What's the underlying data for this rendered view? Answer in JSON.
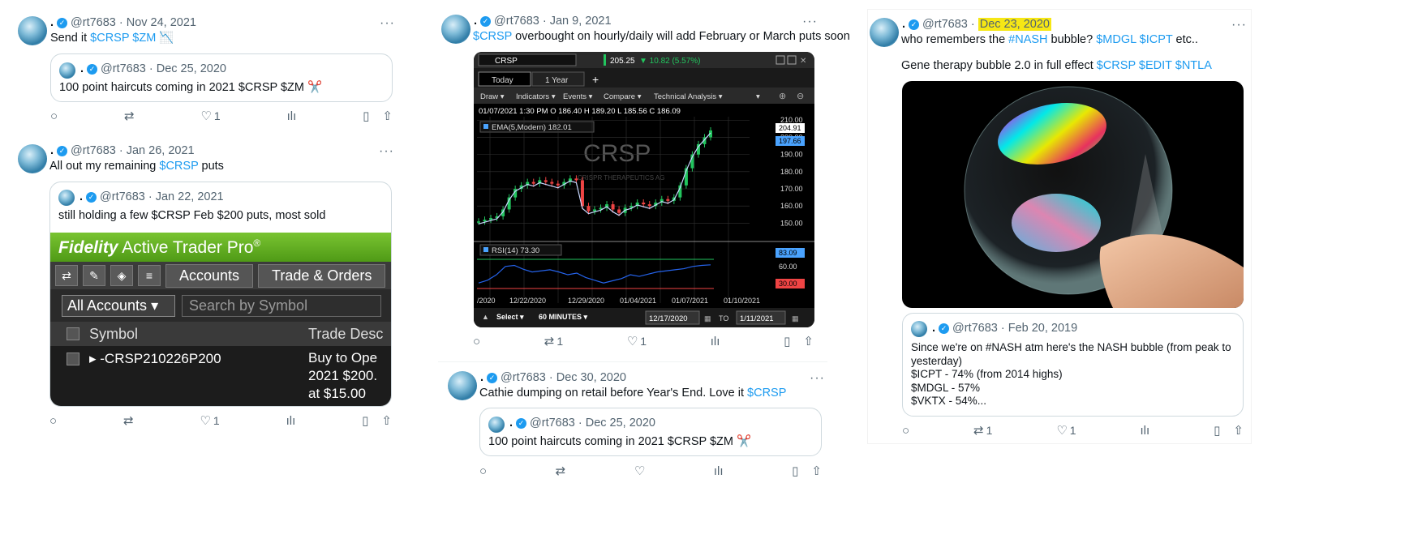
{
  "colors": {
    "accent": "#1d9bf0",
    "muted": "#536471",
    "highlight": "#f6e715",
    "candle_up": "#22c55e",
    "candle_down": "#ef4444",
    "ema": "#c8d8ff",
    "rsi": "#2563eb"
  },
  "t1": {
    "name": ".",
    "verified": "✓",
    "handle": "@rt7683",
    "date": "· Nov 24, 2021",
    "text": "Send it ",
    "c1": "$CRSP",
    "c2": "$ZM",
    "emoji": "📉",
    "quote": {
      "name": ".",
      "handle": "@rt7683",
      "date": "· Dec 25, 2020",
      "text": "100 point haircuts coming in 2021 $CRSP $ZM ✂️"
    },
    "actions": {
      "reply": "",
      "retweet": "",
      "like": "1"
    }
  },
  "t2": {
    "name": ".",
    "handle": "@rt7683",
    "date": "· Jan 26, 2021",
    "text": "All out my remaining ",
    "c1": "$CRSP",
    "text2": " puts",
    "quote": {
      "name": ".",
      "handle": "@rt7683",
      "date": "· Jan 22, 2021",
      "text": "still holding a few $CRSP Feb $200 puts, most sold"
    },
    "fidelity": {
      "title_a": "Fidelity",
      "title_b": " Active Trader Pro",
      "reg": "®",
      "tab1": "Accounts",
      "tab2": "Trade & Orders",
      "accounts": "All Accounts",
      "search": "Search by Symbol",
      "col_symbol": "Symbol",
      "col_desc": "Trade Desc",
      "row_symbol": "-CRSP210226P200",
      "row_desc1": "Buy to Ope",
      "row_desc2": "2021 $200.",
      "row_desc3": "at $15.00"
    },
    "actions": {
      "like": "1"
    }
  },
  "t3": {
    "name": ".",
    "handle": "@rt7683",
    "date": "· Jan 9, 2021",
    "c1": "$CRSP",
    "text": " overbought on hourly/daily will add February or March puts soon",
    "chart": {
      "symbol": "CRSP",
      "price": "205.25",
      "change": "▼ 10.82 (5.57%)",
      "tab_today": "Today",
      "tab_year": "1 Year",
      "menu": [
        "Draw ▾",
        "Indicators ▾",
        "Events ▾",
        "Compare ▾",
        "Technical Analysis ▾"
      ],
      "ohlc": "01/07/2021 1:30 PM  O 186.40  H 189.20  L 185.56  C 186.09",
      "ema": "EMA(5,Modern) 182.01",
      "watermark": "CRSP",
      "watermark_sub": "CRISPR THERAPEUTICS AG",
      "price_ticks": [
        "210.00",
        "200.00",
        "190.00",
        "180.00",
        "170.00",
        "160.00",
        "150.00"
      ],
      "tag_a": "204.91",
      "tag_b": "197.66",
      "rsi_label": "RSI(14) 73.30",
      "rsi_ticks": [
        "60.00"
      ],
      "rsi_tag_hi": "83.09",
      "rsi_tag_lo": "30.00",
      "dates": [
        "/2020",
        "12/22/2020",
        "12/29/2020",
        "01/04/2021",
        "01/07/2021",
        "01/10/2021"
      ],
      "select": "Select ▾",
      "interval": "60 MINUTES ▾",
      "from": "12/17/2020",
      "to_label": "TO",
      "to": "1/11/2021"
    },
    "chart_data": {
      "type": "line",
      "series": [
        {
          "name": "",
          "values": [
            151,
            152,
            153,
            154,
            158,
            165,
            170,
            172,
            174,
            173,
            175,
            174,
            173,
            172,
            174,
            176,
            175,
            160,
            157,
            158,
            159,
            161,
            158,
            156,
            159,
            160,
            162,
            161,
            160,
            162,
            164,
            163,
            165,
            172,
            182,
            190,
            196,
            200,
            204
          ]
        }
      ],
      "rsi": [
        40,
        45,
        55,
        70,
        72,
        65,
        60,
        62,
        64,
        60,
        55,
        58,
        50,
        45,
        40,
        44,
        48,
        55,
        52,
        56,
        60,
        62,
        64,
        66,
        70,
        72,
        73
      ]
    },
    "actions": {
      "retweet": "1",
      "like": "1"
    }
  },
  "t4": {
    "name": ".",
    "handle": "@rt7683",
    "date": "· Dec 30, 2020",
    "text": "Cathie dumping on retail before Year's End. Love it ",
    "c1": "$CRSP",
    "quote": {
      "name": ".",
      "handle": "@rt7683",
      "date": "· Dec 25, 2020",
      "text": "100 point haircuts coming in 2021 $CRSP $ZM ✂️"
    }
  },
  "t5": {
    "name": ".",
    "handle": "@rt7683",
    "date": "Dec 23, 2020",
    "sep": "· ",
    "t1": "who remembers the ",
    "c1": "#NASH",
    "t2": " bubble? ",
    "c2": "$MDGL",
    "c3": "$ICPT",
    "t3": " etc..",
    "line2": "Gene therapy bubble 2.0 in full effect ",
    "c4": "$CRSP",
    "c5": "$EDIT",
    "c6": "$NTLA",
    "quote": {
      "name": ".",
      "handle": "@rt7683",
      "date": "· Feb 20, 2019",
      "l1": "Since we're on #NASH atm here's the NASH bubble (from peak to",
      "l2": "yesterday)",
      "l3": "$ICPT - 74% (from 2014 highs)",
      "l4": "$MDGL - 57%",
      "l5": "$VKTX - 54%..."
    },
    "actions": {
      "retweet": "1",
      "like": "1"
    }
  },
  "icons": {
    "reply": "○",
    "retweet": "⇄",
    "like": "♡",
    "views": "ılı",
    "bookmark": "▯",
    "share": "⇧",
    "more": "···"
  }
}
